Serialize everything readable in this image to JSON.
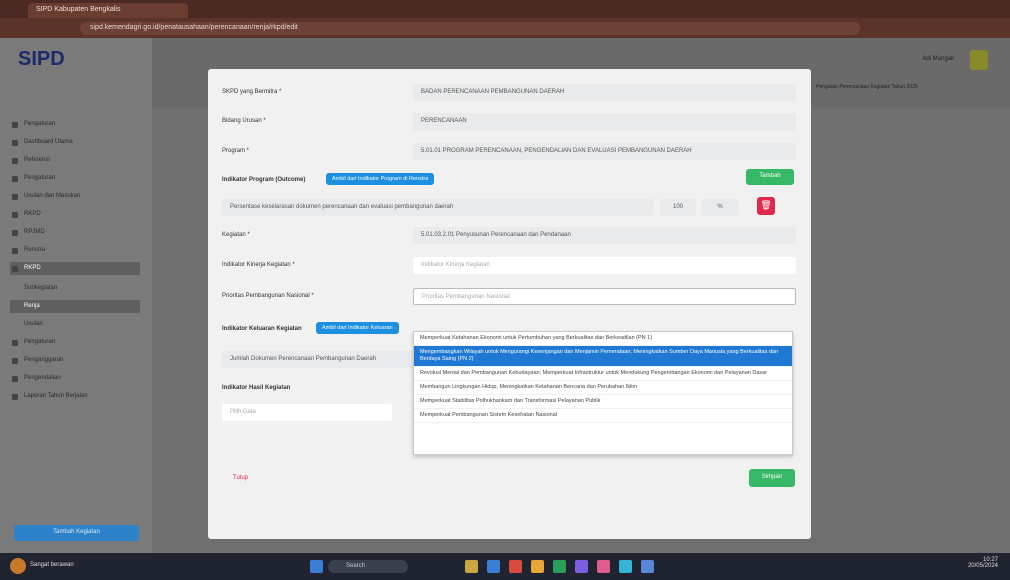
{
  "browser": {
    "tab_title": "SIPD Kabupaten Bengkalis",
    "url": "sipd.kemendagri.go.id/penatausahaan/perencanaan/renja/rkpd/edit"
  },
  "app": {
    "logo": "SIPD"
  },
  "sidebar": {
    "items": [
      {
        "label": "Pengaturan"
      },
      {
        "label": "Dashboard Utama"
      },
      {
        "label": "Referensi"
      },
      {
        "label": "Pengaturan"
      },
      {
        "label": "Usulan dan Masukan"
      },
      {
        "label": "RKPD"
      },
      {
        "label": "RPJMD"
      },
      {
        "label": "Renstra"
      },
      {
        "label": "RKPD"
      },
      {
        "label": "Subkegiatan"
      },
      {
        "label": "Renja"
      },
      {
        "label": "Usulan"
      },
      {
        "label": "Pengaturan"
      },
      {
        "label": "Penganggaran"
      },
      {
        "label": "Pengendalian"
      },
      {
        "label": "Laporan Tahun Berjalan"
      }
    ],
    "bottom_button": "Tambah Kegiatan"
  },
  "modal": {
    "labels": {
      "skpd": "SKPD yang Bermitra *",
      "bidang": "Bidang Urusan *",
      "program": "Program *",
      "indikator_program": "Indikator Program (Outcome)",
      "kegiatan": "Kegiatan *",
      "indikator_kegiatan": "Indikator Kinerja Kegiatan *",
      "prioritas": "Prioritas Pembangunan Nasional *",
      "indikator_keluaran": "Indikator Keluaran Kegiatan",
      "indikator_hasil": "Indikator Hasil Kegiatan"
    },
    "values": {
      "skpd": "BADAN PERENCANAAN PEMBANGUNAN DAERAH",
      "bidang": "PERENCANAAN",
      "program": "5.01.01 PROGRAM PERENCANAAN, PENGENDALIAN DAN EVALUASI PEMBANGUNAN DAERAH",
      "outcome_row": "Persentase keselarasan dokumen perencanaan dan evaluasi pembangunan daerah",
      "outcome_target": "100",
      "outcome_unit": "%",
      "kegiatan": "5.01.03.2.01 Penyusunan Perencanaan dan Pendanaan",
      "indikator_kegiatan_placeholder": "Indikator Kinerja Kegiatan",
      "prioritas_placeholder": "Prioritas Pembangunan Nasional",
      "keluaran_row": "Jumlah Dokumen Perencanaan Pembangunan Daerah",
      "hasil_placeholder": "Pilih Data"
    },
    "buttons": {
      "indikator_program": "Ambil dari Indikator Program di Renstra",
      "tambah": "Tambah",
      "indikator_keluaran": "Ambil dari Indikator Keluaran",
      "tutup": "Tutup",
      "simpan": "Simpan"
    },
    "dropdown_options": [
      "Memperkuat Ketahanan Ekonomi untuk Pertumbuhan yang Berkualitas dan Berkeadilan (PN 1)",
      "Mengembangkan Wilayah untuk Mengurangi Kesenjangan dan Menjamin Pemerataan; Meningkatkan Sumber Daya Manusia yang Berkualitas dan Berdaya Saing (PN 2)",
      "Revolusi Mental dan Pembangunan Kebudayaan; Memperkuat Infrastruktur untuk Mendukung Pengembangan Ekonomi dan Pelayanan Dasar",
      "Membangun Lingkungan Hidup, Meningkatkan Ketahanan Bencana dan Perubahan Iklim",
      "Memperkuat Stabilitas Polhukhankam dan Transformasi Pelayanan Publik",
      "Memperkuat Pembangunan Sistem Kesehatan Nasional"
    ]
  },
  "header": {
    "user": "Adi Mangak",
    "notice": "Pengisian Perencanaan Kegiatan Tahun 2025"
  },
  "taskbar": {
    "user_name": "Sangat berawan",
    "search": "Search",
    "time": "10:27",
    "date": "20/05/2024"
  }
}
